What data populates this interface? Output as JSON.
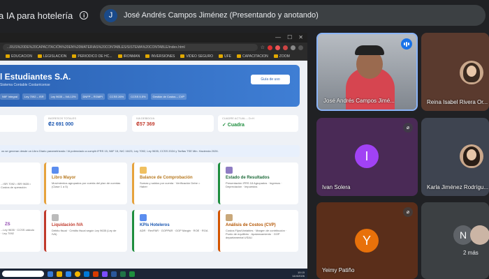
{
  "meeting": {
    "title": "a IA para hotelería",
    "presenter_initial": "J",
    "presenter_label": "José Andrés Campos Jiménez (Presentando y anotando)"
  },
  "browser": {
    "url": "...RUS%20DE%20CAPACITACIÓN%20EN%20MATERIAS%20CONTABLES/SISTEMA%20CONTABLE/index.html",
    "bookmarks": [
      "EDUCACION",
      "LEGISLACION",
      "PERIODICO DE HC...",
      "IRONMAN",
      "INVERSIONES",
      "VIDEO SEGURO",
      "UFE",
      "CAPACITACION",
      "ZOOM"
    ]
  },
  "app": {
    "company": "l Estudiantes S.A.",
    "subtitle": "Sistema Contable Costarricense",
    "guide_button": "Guía de uso",
    "chips": [
      "NIIF Integral",
      "Ley 7092 – ISR",
      "Ley 9635 – IVA 13%",
      "DNFP – RGMPI",
      "CCSS 26%",
      "CCSS 5.5%",
      "Gestión de Costos – CVP"
    ],
    "stats": [
      {
        "label": "INGRESOS TOTALES",
        "value": "₡2 691 000",
        "color": "#1a56b0"
      },
      {
        "label": "IVA DEBIDO/A",
        "value": "₡57 369",
        "color": "#c0392b"
      },
      {
        "label": "CUADRE ACTUAL – D=H",
        "value": "✓ Cuadra",
        "color": "#1e8e3e"
      }
    ],
    "notice": "os se generan desde un Libro Diario parametrizado / IA potenciado a cumplir IFRS 15, NIIF 15, NIC 16/23, Ley 7092, Ley 9635, CCSS 2024 y Tarifas TSE Min. Hacienda 2026.",
    "modules": [
      {
        "title": "",
        "desc": "...ISR 7092 • ISR 9635 • Costos de operación",
        "color": "#e6a23c"
      },
      {
        "title": "Libro Mayor",
        "desc": "Movimientos agrupados por cuenta del plan de cuentas (Clase 1 a 5)",
        "color": "#e6a23c"
      },
      {
        "title": "Balance de Comprobación",
        "desc": "Sumas y saldos por cuenta · Verificación Debe = Haber",
        "color": "#e6a23c"
      },
      {
        "title": "Estado de Resultados",
        "desc": "Presentación IFRS 18 Agrupados · Ingresos · Depreciación · Impuestos",
        "color": "#8e44ad"
      },
      {
        "title": "ZS",
        "desc": "...Ley 9635 · CCSS cálculo · Ley 7092",
        "color": "#8e44ad"
      },
      {
        "title": "Liquidación IVA",
        "desc": "Débito fiscal · Crédito fiscal según Ley 9635 (Ley de IVA)",
        "color": "#c0392b"
      },
      {
        "title": "KPIs Hoteleros",
        "desc": "ADR · RevPAR · GOPPAR · GOP Margin · ROE · ROA",
        "color": "#1e8e3e"
      },
      {
        "title": "Análisis de Costos (CVP)",
        "desc": "Costos Fijos/Variables · Margen de contribución · Punto de equilibrio · Apalancamiento · GOP departamental USALI",
        "color": "#d35400"
      }
    ],
    "clock_time": "10:15",
    "clock_date": "14/4/2026"
  },
  "participants": [
    {
      "name": "José Andrés Campos Jimé...",
      "type": "video",
      "speaking": true
    },
    {
      "name": "Reina Isabel Rivera Or...",
      "type": "photo",
      "muted": false
    },
    {
      "name": "Ivan Solera",
      "type": "initial",
      "initial": "I",
      "color": "#a142f4",
      "muted": true
    },
    {
      "name": "Karla Jiménez Rodrígu...",
      "type": "photo",
      "muted": false
    },
    {
      "name": "Yeimy Patiño",
      "type": "initial",
      "initial": "Y",
      "color": "#e8710a",
      "muted": true
    },
    {
      "name": "2 más",
      "type": "more",
      "initial": "N"
    }
  ]
}
